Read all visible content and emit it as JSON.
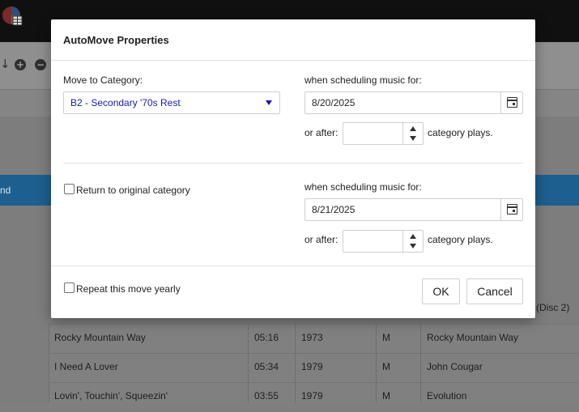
{
  "background": {
    "selected_row_text": "nd",
    "partial_text": "(Disc 2)",
    "rows": [
      {
        "title": "Rocky Mountain Way",
        "length": "05:16",
        "year": "1973",
        "type": "M",
        "artist": "Rocky Mountain Way"
      },
      {
        "title": "I Need A Lover",
        "length": "05:34",
        "year": "1979",
        "type": "M",
        "artist": "John Cougar"
      },
      {
        "title": "Lovin', Touchin', Squeezin'",
        "length": "03:55",
        "year": "1979",
        "type": "M",
        "artist": "Evolution"
      }
    ]
  },
  "dialog": {
    "title": "AutoMove Properties",
    "move_to_label": "Move to Category:",
    "move_to_value": "B2 - Secondary '70s Rest",
    "schedule1": {
      "label": "when scheduling music for:",
      "date": "8/20/2025",
      "or_after": "or after:",
      "plays_value": "",
      "category_plays": "category plays."
    },
    "return_label": "Return to original category",
    "return_checked": false,
    "schedule2": {
      "label": "when scheduling music for:",
      "date": "8/21/2025",
      "or_after": "or after:",
      "plays_value": "",
      "category_plays": "category plays."
    },
    "repeat_label": "Repeat this move yearly",
    "repeat_checked": false,
    "ok_label": "OK",
    "cancel_label": "Cancel"
  },
  "colors": {
    "accent": "#1a1ab8",
    "selected_row": "#1d5f8e"
  }
}
